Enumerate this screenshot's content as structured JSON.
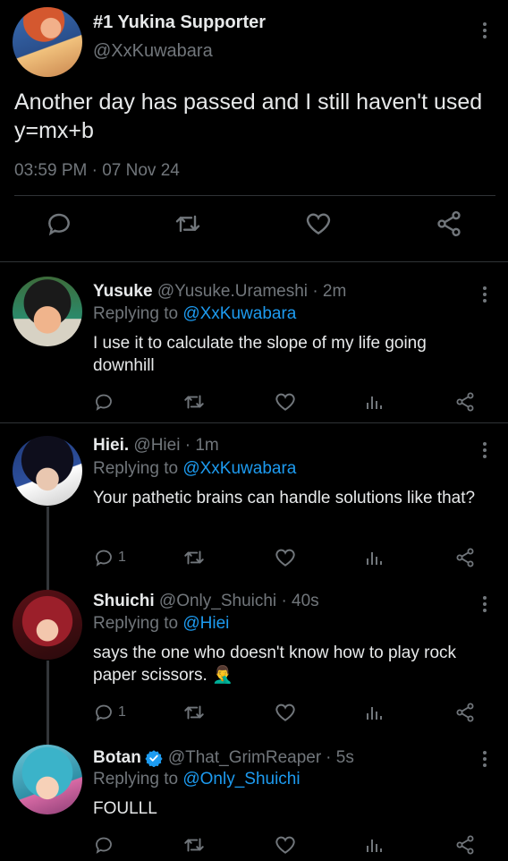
{
  "main_tweet": {
    "display_name": "#1 Yukina Supporter",
    "handle": "@XxKuwabara",
    "text": "Another day has passed and I still haven't used y=mx+b",
    "timestamp": "03:59 PM · 07 Nov 24",
    "actions": [
      "reply-icon",
      "retweet-icon",
      "like-icon",
      "share-icon"
    ]
  },
  "replies": [
    {
      "display_name": "Yusuke",
      "handle": "@Yusuke.Urameshi",
      "time": "· 2m",
      "replying_label": "Replying to",
      "replying_to": "@XxKuwabara",
      "text": "I use it to calculate the slope of my life going downhill",
      "reply_count": "",
      "verified": false
    },
    {
      "display_name": "Hiei.",
      "handle": "@Hiei",
      "time": "· 1m",
      "replying_label": "Replying to",
      "replying_to": "@XxKuwabara",
      "text": "Your pathetic brains can handle solutions like that?",
      "reply_count": "1",
      "verified": false
    },
    {
      "display_name": "Shuichi",
      "handle": "@Only_Shuichi",
      "time": "· 40s",
      "replying_label": "Replying to",
      "replying_to": "@Hiei",
      "text": "says the one who doesn't know how to play rock paper scissors. 🤦‍♂️",
      "reply_count": "1",
      "verified": false
    },
    {
      "display_name": "Botan",
      "handle": "@That_GrimReaper",
      "time": "· 5s",
      "replying_label": "Replying to",
      "replying_to": "@Only_Shuichi",
      "text": "FOULLL",
      "reply_count": "",
      "verified": true
    }
  ],
  "colors": {
    "background": "#000000",
    "text": "#e7e9ea",
    "muted": "#71767b",
    "link": "#1d9bf0",
    "divider": "#2f3336"
  }
}
